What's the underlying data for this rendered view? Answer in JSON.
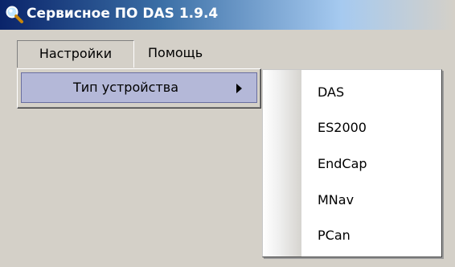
{
  "window": {
    "title": "Сервисное ПО DAS 1.9.4",
    "icon": "magnifier-icon"
  },
  "menubar": {
    "items": [
      {
        "label": "Настройки",
        "state": "open"
      },
      {
        "label": "Помощь"
      }
    ]
  },
  "settings_menu": {
    "items": [
      {
        "label": "Тип устройства",
        "has_submenu": true,
        "state": "highlighted"
      }
    ]
  },
  "device_type_submenu": {
    "items": [
      {
        "label": "DAS"
      },
      {
        "label": "ES2000"
      },
      {
        "label": "EndCap"
      },
      {
        "label": "MNav"
      },
      {
        "label": "PCan"
      }
    ]
  },
  "colors": {
    "title_gradient_start": "#0a246a",
    "menu_highlight": "#b4b8d8",
    "menu_background": "#d4d0c8"
  }
}
